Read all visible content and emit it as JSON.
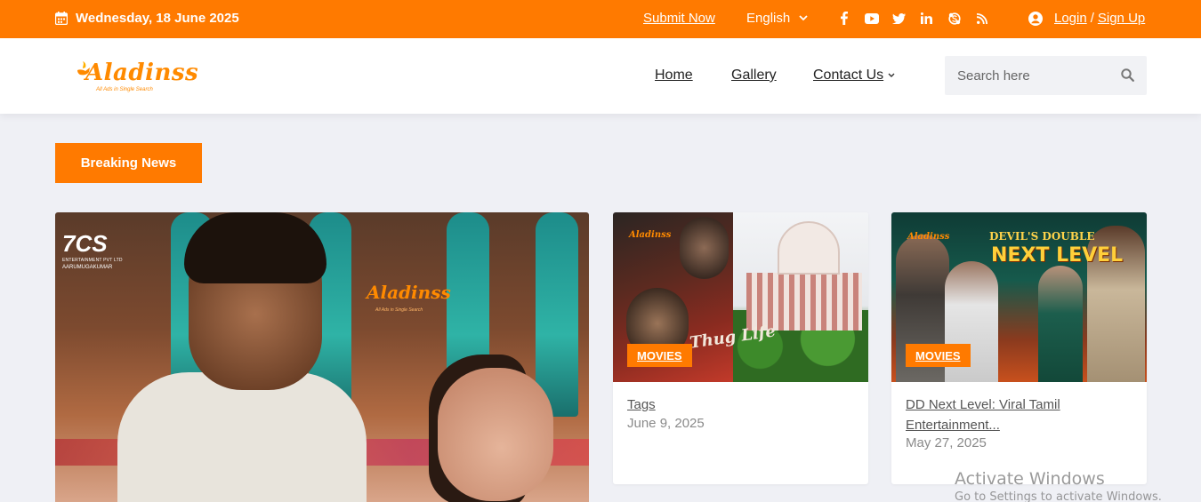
{
  "topbar": {
    "date": "Wednesday, 18 June 2025",
    "submit_label": "Submit Now",
    "language": "English",
    "socials": [
      "facebook-icon",
      "youtube-icon",
      "twitter-icon",
      "linkedin-icon",
      "skype-icon",
      "rss-icon"
    ],
    "login_label": "Login",
    "separator": "/",
    "signup_label": "Sign Up"
  },
  "header": {
    "logo_text": "Aladinss",
    "logo_tagline": "All Ads in Single Search",
    "nav": {
      "home": "Home",
      "gallery": "Gallery",
      "contact": "Contact Us"
    },
    "search": {
      "placeholder": "Search here"
    }
  },
  "breaking_label": "Breaking News",
  "hero": {
    "badge_big": "7CS",
    "badge_small": "ENTERTAINMENT PVT LTD",
    "badge_name": "AARUMUGAKUMAR",
    "watermark": "Aladinss",
    "watermark_tag": "All Ads in Single Search"
  },
  "cards": [
    {
      "category": "MOVIES",
      "title": "Tags",
      "date": "June 9, 2025",
      "poster_logo": "Aladinss",
      "poster_text": "Thug Life"
    },
    {
      "category": "MOVIES",
      "title": "DD Next Level: Viral Tamil Entertainment...",
      "date": "May 27, 2025",
      "poster_logo": "Aladinss",
      "poster_line1": "DEVIL'S DOUBLE",
      "poster_line2": "NEXT LEVEL"
    }
  ],
  "watermark": {
    "line1": "Activate Windows",
    "line2": "Go to Settings to activate Windows."
  },
  "colors": {
    "accent": "#ff7a00",
    "background": "#eff0f5"
  }
}
